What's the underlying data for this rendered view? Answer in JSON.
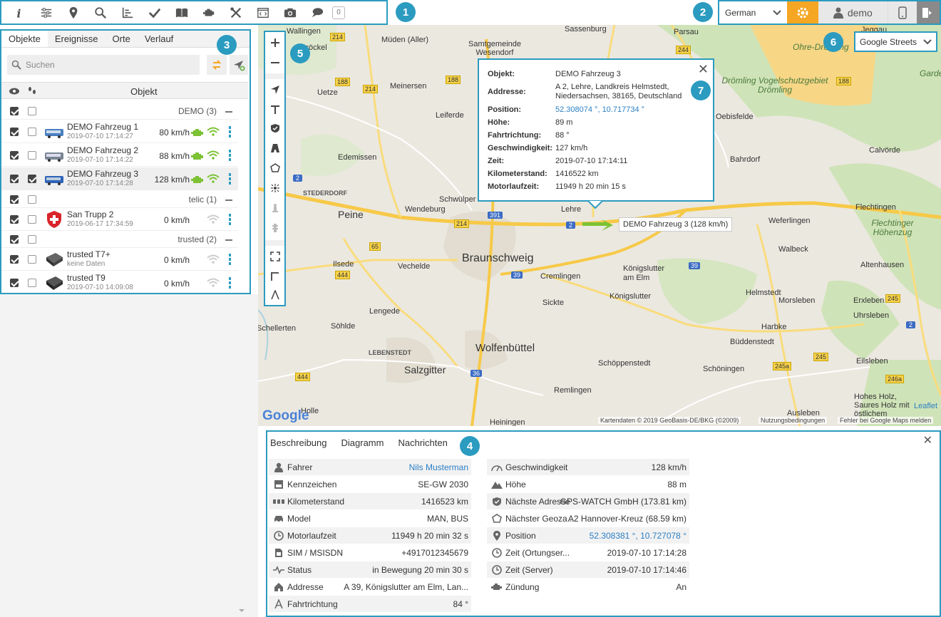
{
  "toolbar": {
    "count": "0"
  },
  "annotations": {
    "n1": "1",
    "n2": "2",
    "n3": "3",
    "n4": "4",
    "n5": "5",
    "n6": "6",
    "n7": "7"
  },
  "topright": {
    "language": "German",
    "user": "demo"
  },
  "left": {
    "tabs": [
      "Objekte",
      "Ereignisse",
      "Orte",
      "Verlauf"
    ],
    "search_placeholder": "Suchen",
    "col_object": "Objekt",
    "groups": [
      {
        "name": "DEMO (3)"
      },
      {
        "name": "telic (1)"
      },
      {
        "name": "trusted (2)"
      }
    ],
    "vehicles": [
      {
        "name": "DEMO Fahrzeug 1",
        "time": "2019-07-10 17:14:27",
        "speed": "80 km/h"
      },
      {
        "name": "DEMO Fahrzeug 2",
        "time": "2019-07-10 17:14:22",
        "speed": "88 km/h"
      },
      {
        "name": "DEMO Fahrzeug 3",
        "time": "2019-07-10 17:14:28",
        "speed": "128 km/h"
      },
      {
        "name": "San Trupp 2",
        "time": "2019-06-17 17:34:59",
        "speed": "0 km/h"
      },
      {
        "name": "trusted T7+",
        "time": "keine Daten",
        "speed": "0 km/h"
      },
      {
        "name": "trusted T9",
        "time": "2019-07-10 14:09:08",
        "speed": "0 km/h"
      }
    ]
  },
  "map": {
    "layer": "Google Streets",
    "tooltip": "DEMO Fahrzeug 3 (128 km/h)",
    "attribution": "Kartendaten © 2019 GeoBasis-DE/BKG (©2009)",
    "terms": "Nutzungsbedingungen",
    "report": "Fehler bei Google Maps melden",
    "leaflet": "Leaflet",
    "google": "Google",
    "places": [
      {
        "name": "Wallingen"
      },
      {
        "name": "Bröckel"
      },
      {
        "name": "Müden (Aller)"
      },
      {
        "name": "Samtgemeinde Wesendorf"
      },
      {
        "name": "Sassenburg"
      },
      {
        "name": "Parsau"
      },
      {
        "name": "Jeggau"
      },
      {
        "name": "Ohre-Drömling"
      },
      {
        "name": "Uetze"
      },
      {
        "name": "Meinersen"
      },
      {
        "name": "Leiferde"
      },
      {
        "name": "Edemissen"
      },
      {
        "name": "Drömling Vogelschutzgebiet Drömling"
      },
      {
        "name": "Oebisfelde"
      },
      {
        "name": "Calvörde"
      },
      {
        "name": "Bahrdorf"
      },
      {
        "name": "STEDERDORF"
      },
      {
        "name": "Peine"
      },
      {
        "name": "Wendeburg"
      },
      {
        "name": "Schwülper"
      },
      {
        "name": "Lehre"
      },
      {
        "name": "Weferlingen"
      },
      {
        "name": "Flechtingen"
      },
      {
        "name": "Flechtinger Höhenzug"
      },
      {
        "name": "Walbeck"
      },
      {
        "name": "Braunschweig"
      },
      {
        "name": "Ilsede"
      },
      {
        "name": "Vechelde"
      },
      {
        "name": "Cremlingen"
      },
      {
        "name": "Königslutter am Elm"
      },
      {
        "name": "Altenhausen"
      },
      {
        "name": "Königslutter"
      },
      {
        "name": "Helmstedt"
      },
      {
        "name": "Erxleben"
      },
      {
        "name": "Lengede"
      },
      {
        "name": "Sickte"
      },
      {
        "name": "Morsleben"
      },
      {
        "name": "Uhrsleben"
      },
      {
        "name": "Schellerten"
      },
      {
        "name": "Söhlde"
      },
      {
        "name": "Harbke"
      },
      {
        "name": "Büddenstedt"
      },
      {
        "name": "LEBENSTEDT"
      },
      {
        "name": "Wolfenbüttel"
      },
      {
        "name": "Salzgitter"
      },
      {
        "name": "Schöppenstedt"
      },
      {
        "name": "Eilsleben"
      },
      {
        "name": "Schöningen"
      },
      {
        "name": "Remlingen"
      },
      {
        "name": "Hohes Holz, Saures Holz mit östlichem"
      },
      {
        "name": "Holle"
      },
      {
        "name": "Ausleben"
      },
      {
        "name": "Heiningen"
      },
      {
        "name": "Garde"
      }
    ],
    "roads": [
      "214",
      "188",
      "214",
      "188",
      "244",
      "188",
      "2",
      "391",
      "214",
      "65",
      "444",
      "39",
      "2",
      "39",
      "245",
      "245a",
      "2",
      "245",
      "246a",
      "36",
      "444",
      "188"
    ]
  },
  "popup": {
    "rows": [
      {
        "label": "Objekt:",
        "value": "DEMO Fahrzeug 3"
      },
      {
        "label": "Addresse:",
        "value": "A 2, Lehre, Landkreis Helmstedt, Niedersachsen, 38165, Deutschland"
      },
      {
        "label": "Position:",
        "value": "52.308074 °, 10.717734 °"
      },
      {
        "label": "Höhe:",
        "value": "89 m"
      },
      {
        "label": "Fahrtrichtung:",
        "value": "88 °"
      },
      {
        "label": "Geschwindigkeit:",
        "value": "127 km/h"
      },
      {
        "label": "Zeit:",
        "value": "2019-07-10 17:14:11"
      },
      {
        "label": "Kilometerstand:",
        "value": "1416522 km"
      },
      {
        "label": "Motorlaufzeit:",
        "value": "11949 h 20 min 15 s"
      }
    ]
  },
  "bottom": {
    "tabs": [
      "Beschreibung",
      "Diagramm",
      "Nachrichten"
    ],
    "left_rows": [
      {
        "label": "Fahrer",
        "value": "Nils Musterman",
        "icon": "person-icon"
      },
      {
        "label": "Kennzeichen",
        "value": "SE-GW 2030",
        "icon": "plate-icon"
      },
      {
        "label": "Kilometerstand",
        "value": "1416523 km",
        "icon": "odometer-icon"
      },
      {
        "label": "Model",
        "value": "MAN, BUS",
        "icon": "car-icon"
      },
      {
        "label": "Motorlaufzeit",
        "value": "11949 h 20 min 32 s",
        "icon": "clock-icon"
      },
      {
        "label": "SIM / MSISDN",
        "value": "+4917012345679",
        "icon": "sim-icon"
      },
      {
        "label": "Status",
        "value": "in Bewegung 20 min 30 s",
        "icon": "pulse-icon"
      },
      {
        "label": "Addresse",
        "value": "A 39, Königslutter am Elm, Lan...",
        "icon": "house-icon"
      },
      {
        "label": "Fahrtrichtung",
        "value": "84 °",
        "icon": "compass-icon"
      }
    ],
    "right_rows": [
      {
        "label": "Geschwindigkeit",
        "value": "128 km/h",
        "icon": "speedometer-icon"
      },
      {
        "label": "Höhe",
        "value": "88 m",
        "icon": "mountain-icon"
      },
      {
        "label": "Nächste Adresse",
        "value": "GPS-WATCH GmbH (173.81 km)",
        "icon": "shield-icon"
      },
      {
        "label": "Nächster Geoza...",
        "value": "A2 Hannover-Kreuz (68.59 km)",
        "icon": "geofence-icon"
      },
      {
        "label": "Position",
        "value": "52.308381 °, 10.727078 °",
        "icon": "pin-icon"
      },
      {
        "label": "Zeit (Ortungser...",
        "value": "2019-07-10 17:14:28",
        "icon": "clock-icon"
      },
      {
        "label": "Zeit (Server)",
        "value": "2019-07-10 17:14:46",
        "icon": "clock-icon"
      },
      {
        "label": "Zündung",
        "value": "An",
        "icon": "engine-icon"
      }
    ]
  }
}
